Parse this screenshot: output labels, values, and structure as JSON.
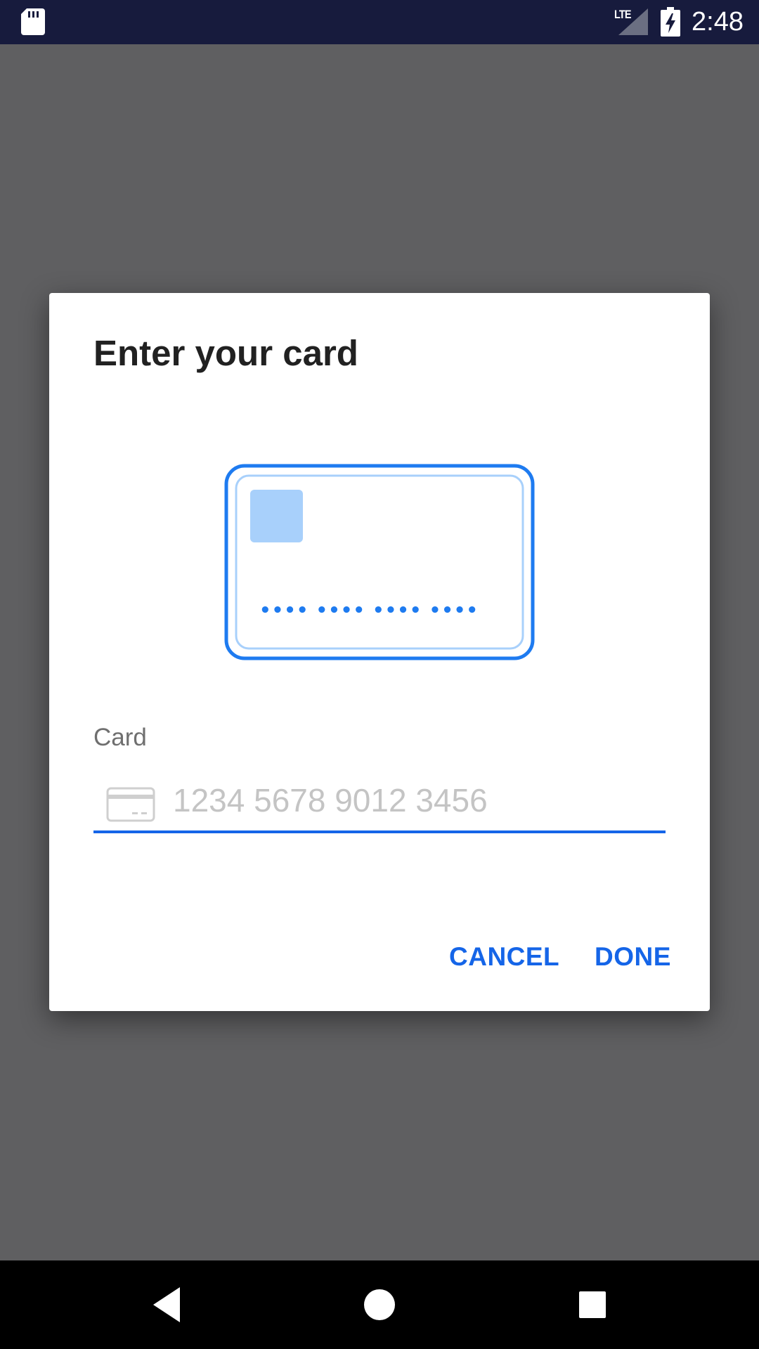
{
  "status_bar": {
    "time": "2:48",
    "network": "LTE",
    "icons": [
      "sd-card-icon",
      "signal-icon",
      "battery-charging-icon"
    ]
  },
  "dialog": {
    "title": "Enter your card",
    "illustration": {
      "icon": "credit-card-icon",
      "masked_number": "•••• •••• •••• ••••"
    },
    "card_field": {
      "label": "Card",
      "value": "",
      "placeholder": "1234 5678 9012 3456",
      "icon": "credit-card-outline-icon"
    },
    "buttons": {
      "cancel_label": "CANCEL",
      "done_label": "DONE"
    }
  },
  "nav_bar": {
    "icons": [
      "back-icon",
      "home-icon",
      "recents-icon"
    ]
  },
  "colors": {
    "accent": "#1565e8",
    "status_bar": "#171b3d",
    "scrim": "#5f5f61",
    "card_outline": "#1e7bf0",
    "card_chip": "#a8d0fb"
  }
}
